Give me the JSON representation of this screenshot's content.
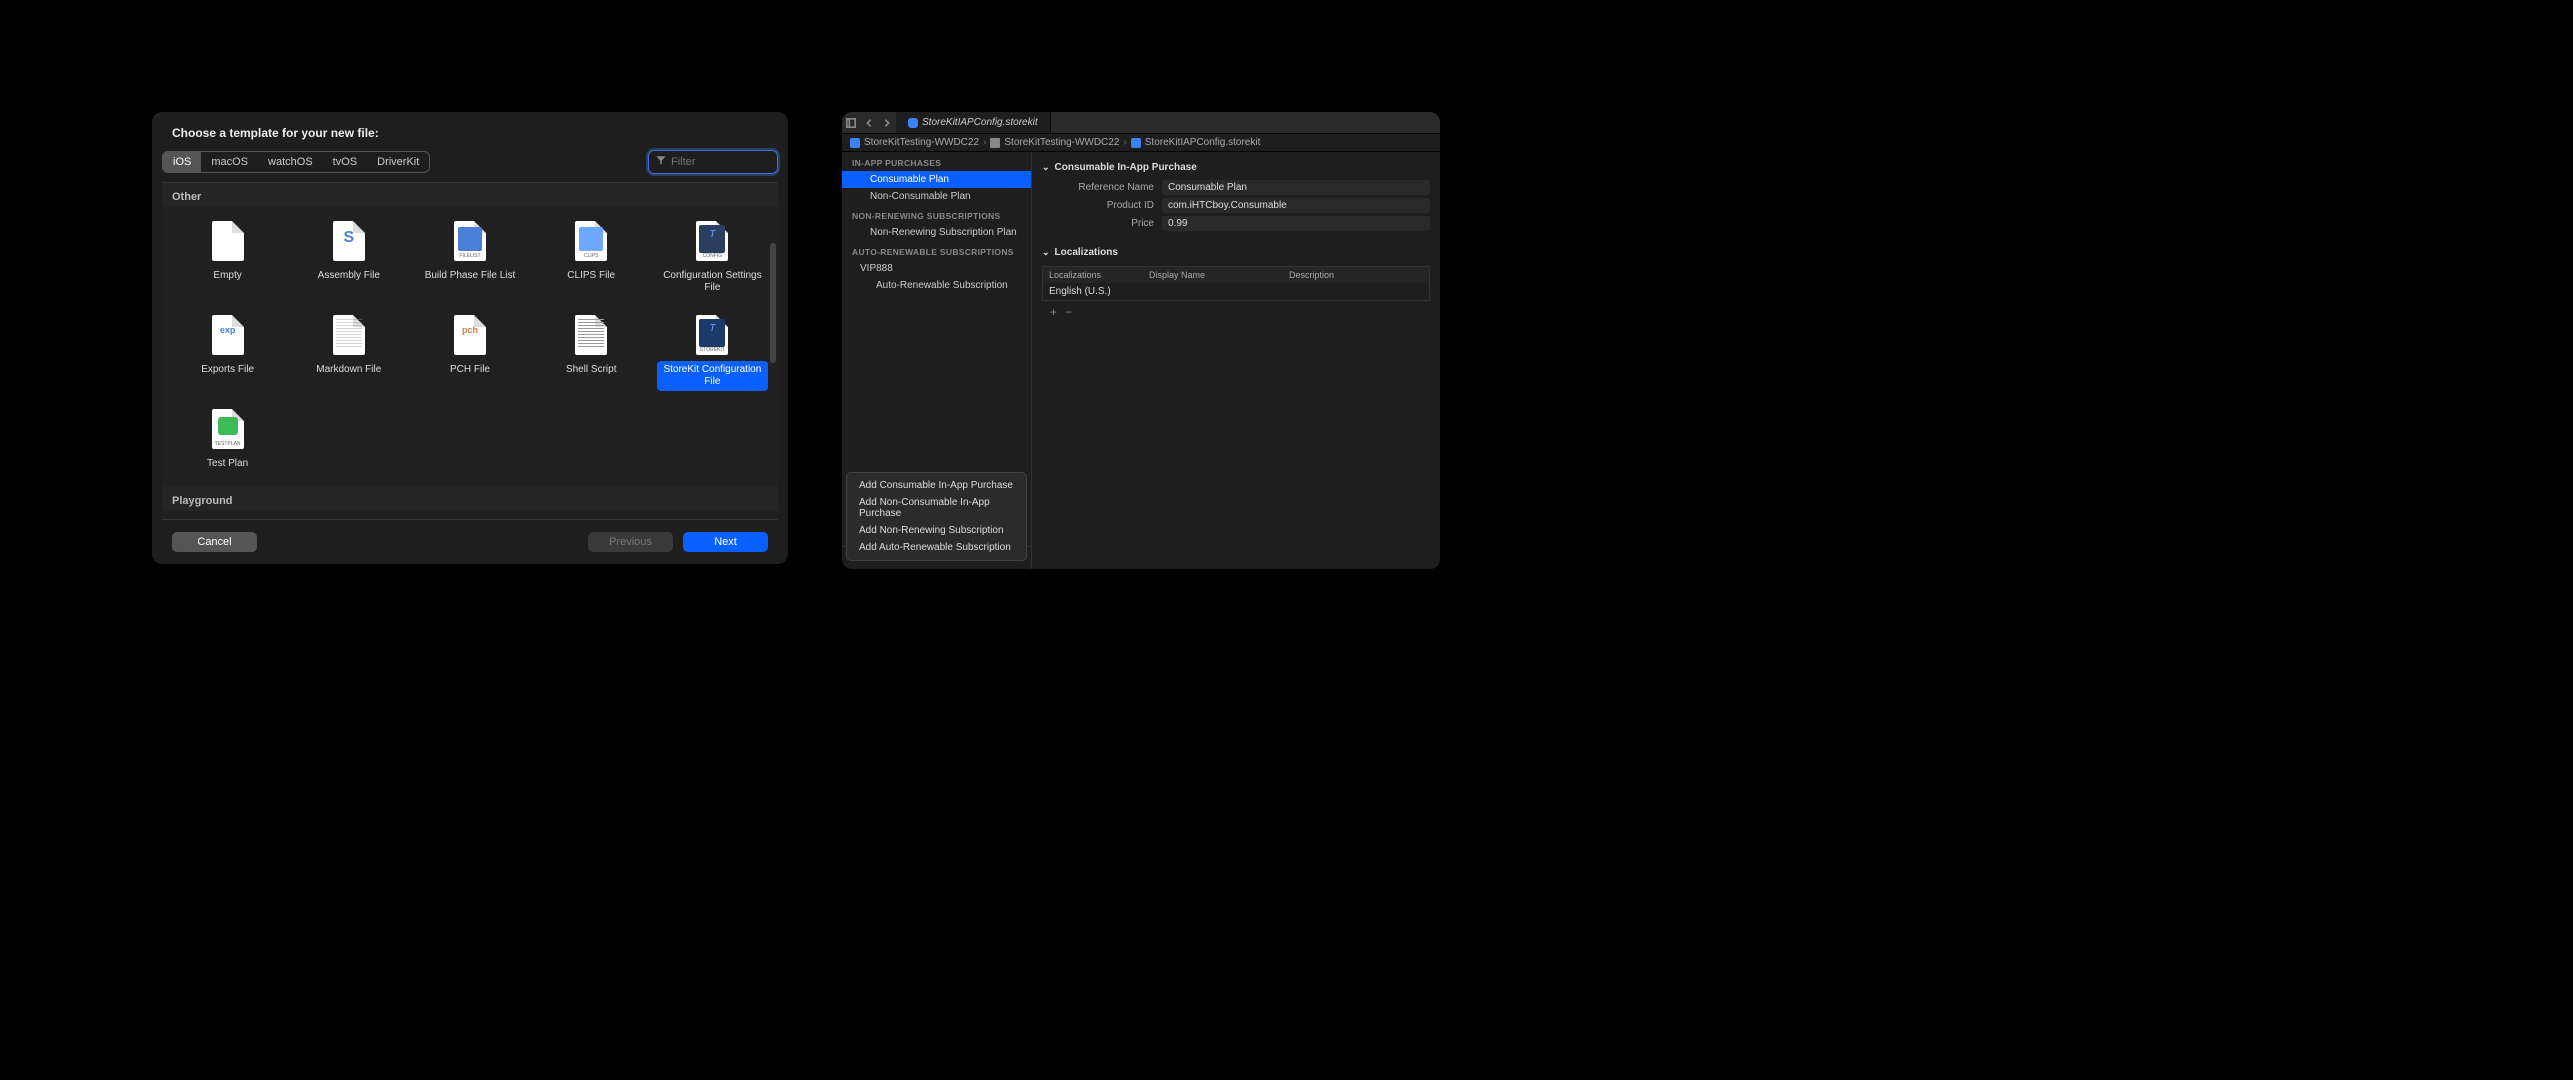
{
  "dialog": {
    "title": "Choose a template for your new file:",
    "platforms": [
      "iOS",
      "macOS",
      "watchOS",
      "tvOS",
      "DriverKit"
    ],
    "selected_platform": "iOS",
    "filter_placeholder": "Filter",
    "sections": {
      "other": "Other",
      "playground": "Playground"
    },
    "templates": [
      "Empty",
      "Assembly File",
      "Build Phase File List",
      "CLIPS File",
      "Configuration Settings File",
      "Exports File",
      "Markdown File",
      "PCH File",
      "Shell Script",
      "StoreKit Configuration File",
      "Test Plan"
    ],
    "selected_template": "StoreKit Configuration File",
    "buttons": {
      "cancel": "Cancel",
      "previous": "Previous",
      "next": "Next"
    }
  },
  "editor": {
    "tab_title": "StoreKitIAPConfig.storekit",
    "breadcrumb": [
      "StoreKitTesting-WWDC22",
      "StoreKitTesting-WWDC22",
      "StoreKitIAPConfig.storekit"
    ],
    "sidebar": {
      "groups": [
        {
          "header": "IN-APP PURCHASES",
          "items": [
            "Consumable Plan",
            "Non-Consumable Plan"
          ]
        },
        {
          "header": "NON-RENEWING SUBSCRIPTIONS",
          "items": [
            "Non-Renewing Subscription Plan"
          ]
        },
        {
          "header": "AUTO-RENEWABLE SUBSCRIPTIONS",
          "items": [
            "VIP888",
            "Auto-Renewable Subscription"
          ]
        }
      ],
      "selected": "Consumable Plan",
      "add_menu": [
        "Add Consumable In-App Purchase",
        "Add Non-Consumable In-App Purchase",
        "Add Non-Renewing Subscription",
        "Add Auto-Renewable Subscription"
      ]
    },
    "main": {
      "section_title": "Consumable In-App Purchase",
      "fields": {
        "reference_name": {
          "label": "Reference Name",
          "value": "Consumable Plan"
        },
        "product_id": {
          "label": "Product ID",
          "value": "com.iHTCboy.Consumable"
        },
        "price": {
          "label": "Price",
          "value": "0.99"
        }
      },
      "localizations_title": "Localizations",
      "loc_headers": {
        "loc": "Localizations",
        "display": "Display Name",
        "desc": "Description"
      },
      "loc_rows": [
        {
          "loc": "English (U.S.)",
          "display": "",
          "desc": ""
        }
      ]
    }
  }
}
